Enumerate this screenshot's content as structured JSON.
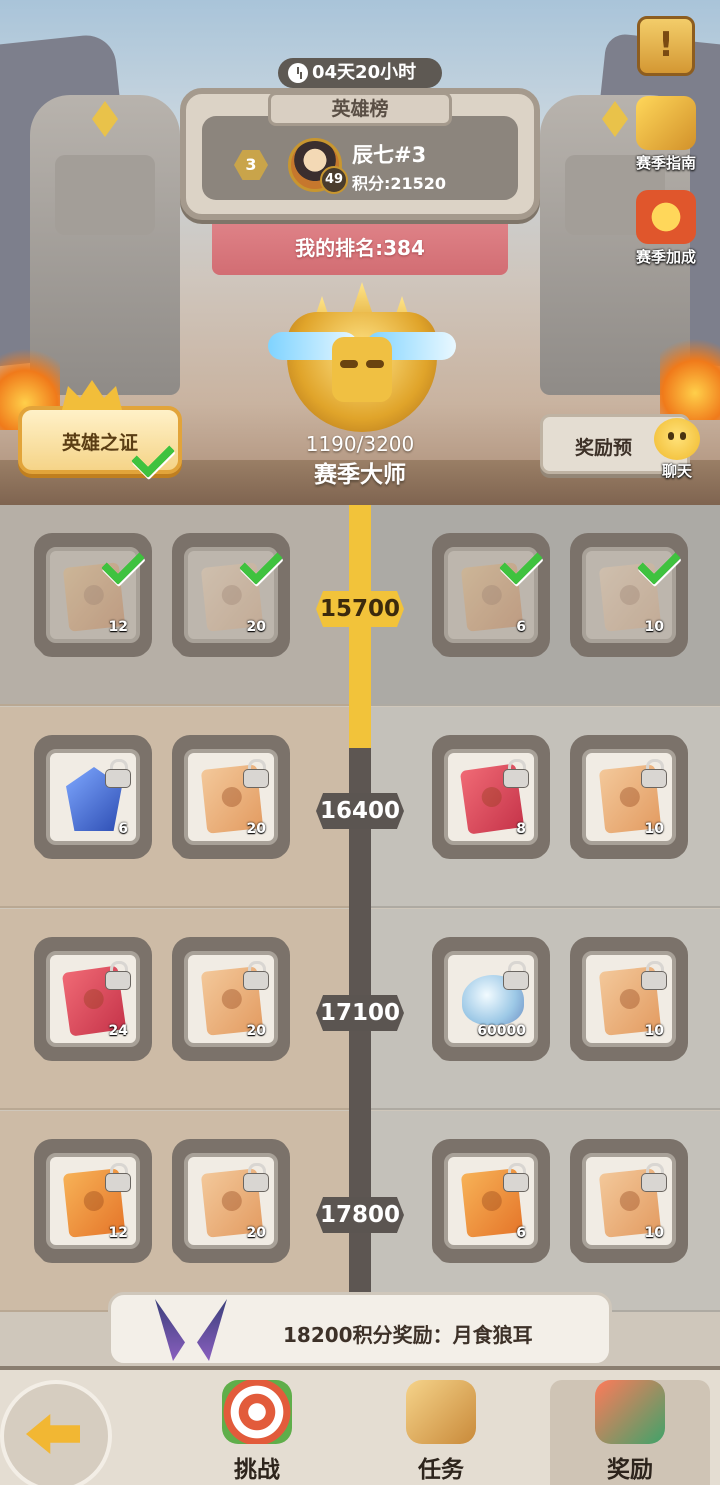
{
  "header": {
    "timer": "04天20小时",
    "board_title": "英雄榜",
    "top_player": {
      "rank": "3",
      "name": "辰七#3",
      "level": "49",
      "score": "积分:21520"
    },
    "my_rank": "我的排名:384"
  },
  "season": {
    "progress": "1190/3200",
    "title": "赛季大师"
  },
  "buttons": {
    "hero_pass": "英雄之证",
    "reward_preview": "奖励预",
    "season_guide": "赛季指南",
    "season_bonus": "赛季加成",
    "chat": "聊天",
    "notice": "!"
  },
  "colors": {
    "accent": "#f2c33a",
    "spine": "#5d5652",
    "check": "#3fc23f"
  },
  "tiers": [
    {
      "score": "15700",
      "claimed": true,
      "rewards": [
        {
          "icon": "fire-scroll",
          "qty": "12"
        },
        {
          "icon": "paw-scroll",
          "qty": "20"
        },
        {
          "icon": "fire-scroll",
          "qty": "6"
        },
        {
          "icon": "paw-scroll",
          "qty": "10"
        }
      ]
    },
    {
      "score": "16400",
      "claimed": false,
      "rewards": [
        {
          "icon": "blue-crystal",
          "qty": "6"
        },
        {
          "icon": "paw-scroll",
          "qty": "20"
        },
        {
          "icon": "red-card",
          "qty": "8"
        },
        {
          "icon": "paw-scroll",
          "qty": "10"
        }
      ]
    },
    {
      "score": "17100",
      "claimed": false,
      "rewards": [
        {
          "icon": "red-card",
          "qty": "24"
        },
        {
          "icon": "paw-scroll",
          "qty": "20"
        },
        {
          "icon": "pearl-shell",
          "qty": "60000"
        },
        {
          "icon": "paw-scroll",
          "qty": "10"
        }
      ]
    },
    {
      "score": "17800",
      "claimed": false,
      "rewards": [
        {
          "icon": "fire-scroll",
          "qty": "12"
        },
        {
          "icon": "paw-scroll",
          "qty": "20"
        },
        {
          "icon": "fire-scroll",
          "qty": "6"
        },
        {
          "icon": "paw-scroll",
          "qty": "10"
        }
      ]
    }
  ],
  "next_reward": "18200积分奖励：月食狼耳",
  "nav": {
    "tabs": [
      {
        "label": "挑战",
        "icon": "target-icon"
      },
      {
        "label": "任务",
        "icon": "scroll-task-icon"
      },
      {
        "label": "奖励",
        "icon": "gift-icon"
      }
    ],
    "active": "奖励"
  }
}
